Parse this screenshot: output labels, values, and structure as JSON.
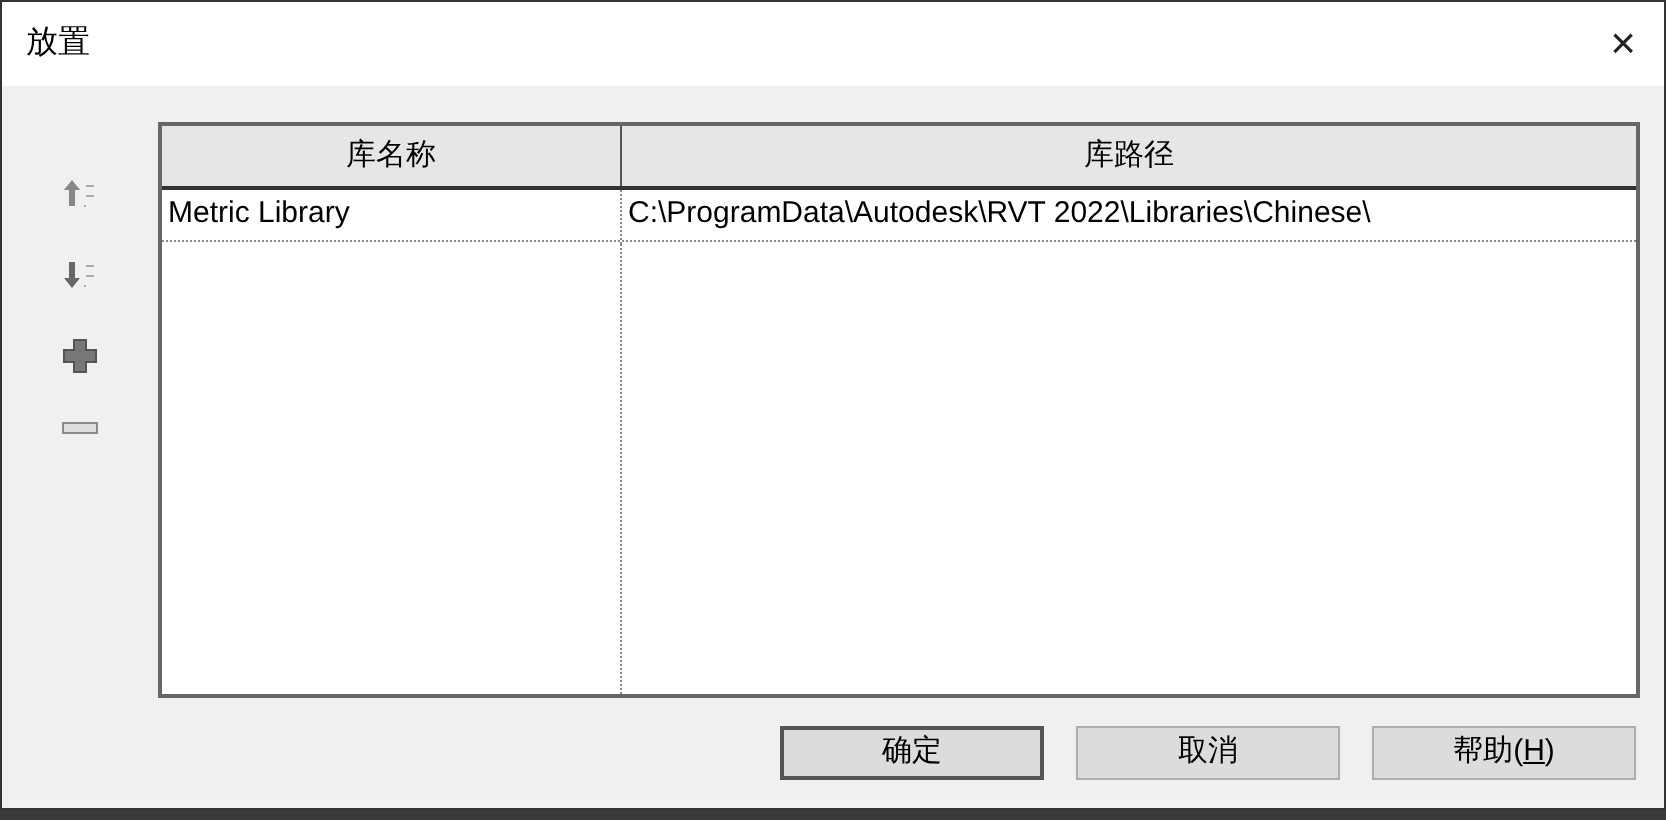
{
  "window": {
    "title": "放置",
    "close": "×"
  },
  "table": {
    "columns": [
      "库名称",
      "库路径"
    ],
    "rows": [
      [
        "Metric Library",
        "C:\\ProgramData\\Autodesk\\RVT 2022\\Libraries\\Chinese\\"
      ]
    ]
  },
  "buttons": [
    {
      "label": "确定",
      "default": true
    },
    {
      "label": "取消",
      "default": false
    },
    {
      "label": "帮助(",
      "default": false,
      "accesskey": "H",
      "label_end": ")"
    }
  ]
}
